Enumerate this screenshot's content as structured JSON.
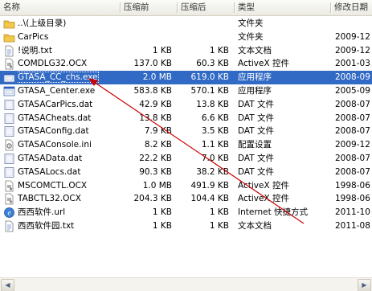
{
  "columns": {
    "name": "名称",
    "size": "压缩前",
    "csize": "压缩后",
    "type": "类型",
    "date": "修改日期"
  },
  "files": [
    {
      "name": "..\\(上级目录)",
      "size": "",
      "csize": "",
      "type": "文件夹",
      "date": "",
      "icon": "folder-up-icon"
    },
    {
      "name": "CarPics",
      "size": "",
      "csize": "",
      "type": "文件夹",
      "date": "2009-12",
      "icon": "folder-icon"
    },
    {
      "name": "!说明.txt",
      "size": "1 KB",
      "csize": "1 KB",
      "type": "文本文档",
      "date": "2009-12",
      "icon": "text-file-icon"
    },
    {
      "name": "COMDLG32.OCX",
      "size": "137.0 KB",
      "csize": "60.3 KB",
      "type": "ActiveX 控件",
      "date": "2001-03",
      "icon": "ocx-file-icon"
    },
    {
      "name": "GTASA_CC_chs.exe",
      "size": "2.0 MB",
      "csize": "619.0 KB",
      "type": "应用程序",
      "date": "2008-09",
      "icon": "exe-file-icon",
      "selected": true
    },
    {
      "name": "GTASA_Center.exe",
      "size": "583.8 KB",
      "csize": "570.1 KB",
      "type": "应用程序",
      "date": "2005-09",
      "icon": "exe-file-icon"
    },
    {
      "name": "GTASACarPics.dat",
      "size": "42.9 KB",
      "csize": "13.8 KB",
      "type": "DAT 文件",
      "date": "2008-07",
      "icon": "dat-file-icon"
    },
    {
      "name": "GTASACheats.dat",
      "size": "13.8 KB",
      "csize": "6.6 KB",
      "type": "DAT 文件",
      "date": "2008-07",
      "icon": "dat-file-icon"
    },
    {
      "name": "GTASAConfig.dat",
      "size": "7.9 KB",
      "csize": "3.5 KB",
      "type": "DAT 文件",
      "date": "2008-07",
      "icon": "dat-file-icon"
    },
    {
      "name": "GTASAConsole.ini",
      "size": "8.2 KB",
      "csize": "1.1 KB",
      "type": "配置设置",
      "date": "2009-12",
      "icon": "ini-file-icon"
    },
    {
      "name": "GTASAData.dat",
      "size": "22.2 KB",
      "csize": "7.0 KB",
      "type": "DAT 文件",
      "date": "2008-07",
      "icon": "dat-file-icon"
    },
    {
      "name": "GTASALocs.dat",
      "size": "90.3 KB",
      "csize": "38.2 KB",
      "type": "DAT 文件",
      "date": "2008-07",
      "icon": "dat-file-icon"
    },
    {
      "name": "MSCOMCTL.OCX",
      "size": "1.0 MB",
      "csize": "491.9 KB",
      "type": "ActiveX 控件",
      "date": "1998-06",
      "icon": "ocx-file-icon"
    },
    {
      "name": "TABCTL32.OCX",
      "size": "204.3 KB",
      "csize": "104.4 KB",
      "type": "ActiveX 控件",
      "date": "1998-06",
      "icon": "ocx-file-icon"
    },
    {
      "name": "西西软件.url",
      "size": "1 KB",
      "csize": "1 KB",
      "type": "Internet 快捷方式",
      "date": "2011-10",
      "icon": "url-shortcut-icon"
    },
    {
      "name": "西西软件园.txt",
      "size": "1 KB",
      "csize": "1 KB",
      "type": "文本文档",
      "date": "2011-08",
      "icon": "text-file-icon"
    }
  ],
  "colors": {
    "selection": "#316ac5",
    "annotation_arrow": "#cc0000",
    "folder": "#f2c94c"
  }
}
